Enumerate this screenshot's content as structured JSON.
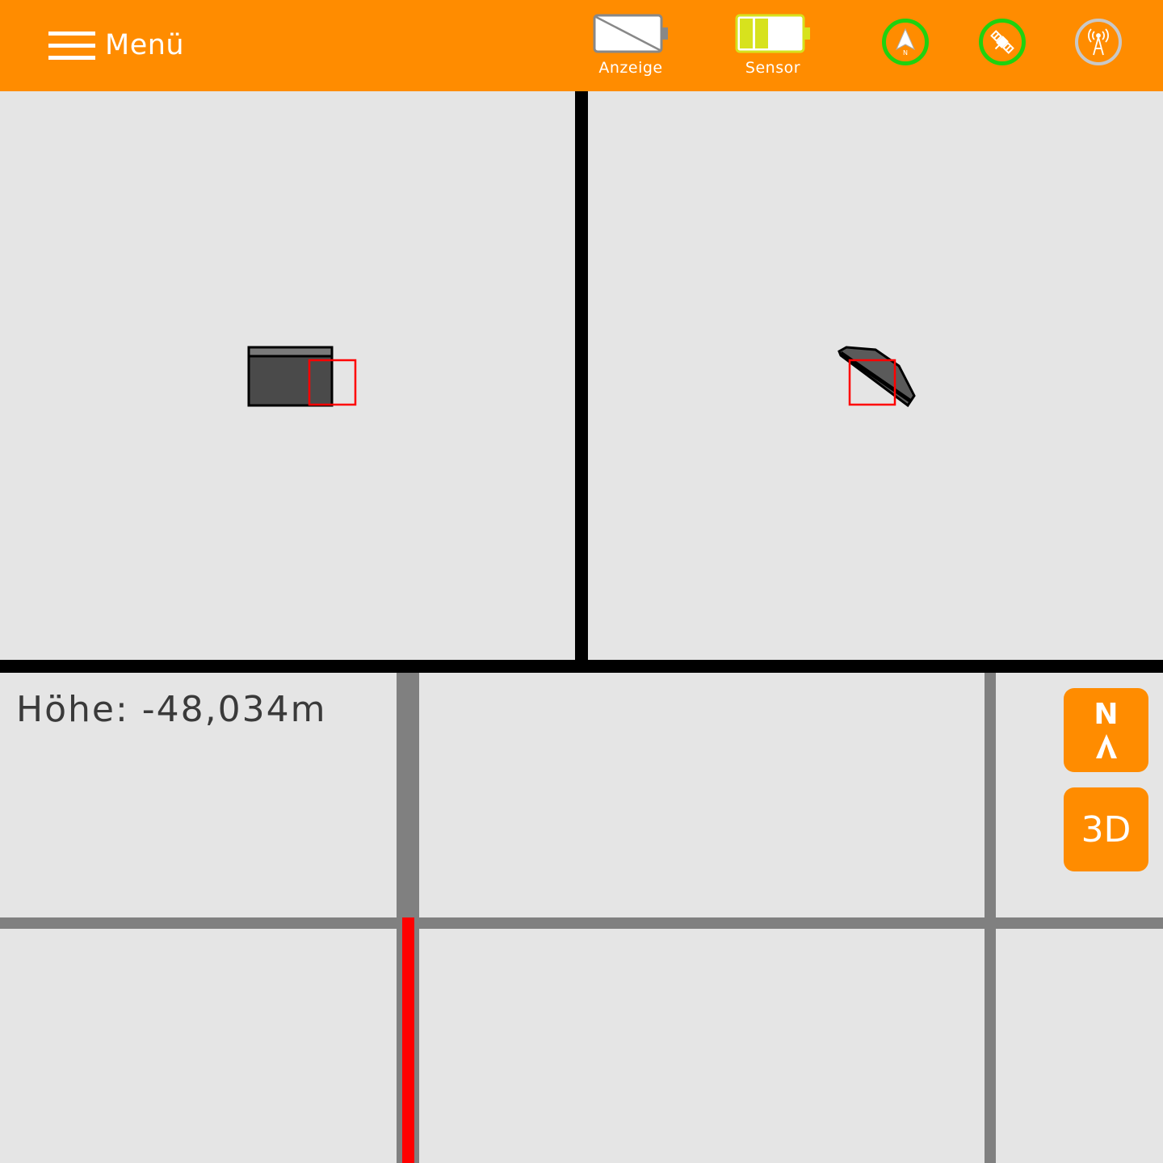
{
  "header": {
    "menu_label": "Menü",
    "display_battery_label": "Anzeige",
    "sensor_battery_label": "Sensor",
    "icons": {
      "compass": "compass-north-icon",
      "satellite": "satellite-icon",
      "radio": "radio-tower-icon"
    },
    "colors": {
      "accent": "#ff8c00",
      "status_ok": "#1fd20f",
      "status_off": "#c8c8c8",
      "battery_sensor_fill": "#d7e21d"
    }
  },
  "map": {
    "height_label": "Höhe:",
    "height_value": "-48,034m",
    "north_button_label": "N",
    "view_3d_button_label": "3D",
    "colors": {
      "grid_line": "#808080",
      "track": "#ff0000",
      "marker": "#ff0000"
    }
  }
}
